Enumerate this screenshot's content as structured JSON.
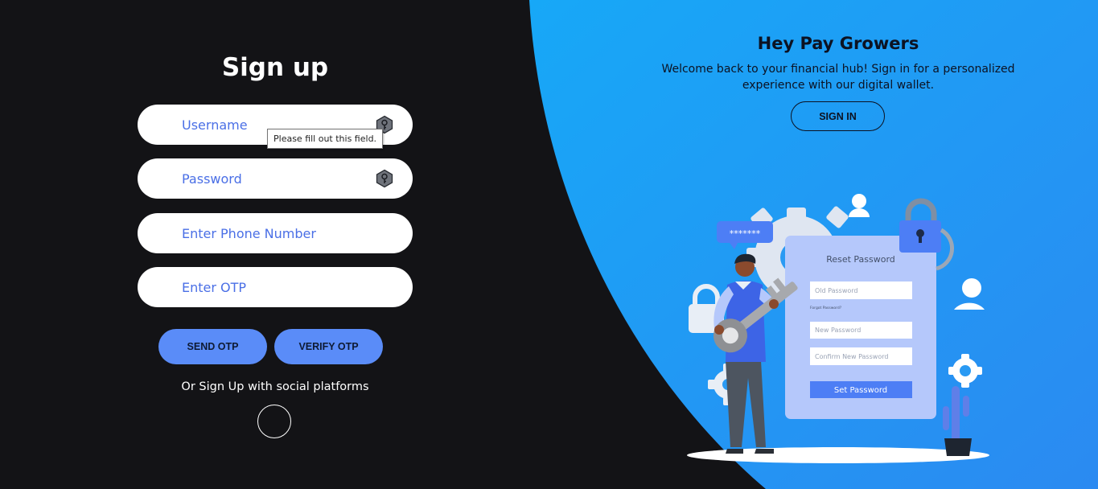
{
  "signup": {
    "title": "Sign up",
    "fields": {
      "username_placeholder": "Username",
      "password_placeholder": "Password",
      "phone_placeholder": "Enter Phone Number",
      "otp_placeholder": "Enter OTP"
    },
    "tooltip": "Please fill out this field.",
    "send_otp_label": "SEND OTP",
    "verify_otp_label": "VERIFY OTP",
    "social_text": "Or Sign Up with social platforms"
  },
  "hero": {
    "title": "Hey Pay Growers",
    "text": "Welcome back to your financial hub!  Sign in for a personalized experience with our digital wallet.",
    "signin_label": "SIGN IN"
  },
  "illustration": {
    "card_title": "Reset Password",
    "old_password": "Old Password",
    "forgot_password": "Forgot Password?",
    "new_password": "New Password",
    "confirm_password": "Confirm New Password",
    "set_password": "Set Password",
    "masked_password": "*******"
  },
  "colors": {
    "left_bg": "#131316",
    "right_bg_start": "#17a6f6",
    "right_bg_end": "#2b8cf2",
    "button_blue": "#5a8cf8",
    "input_text": "#4a6fe6"
  },
  "icons": {
    "field_key": "key-icon"
  }
}
